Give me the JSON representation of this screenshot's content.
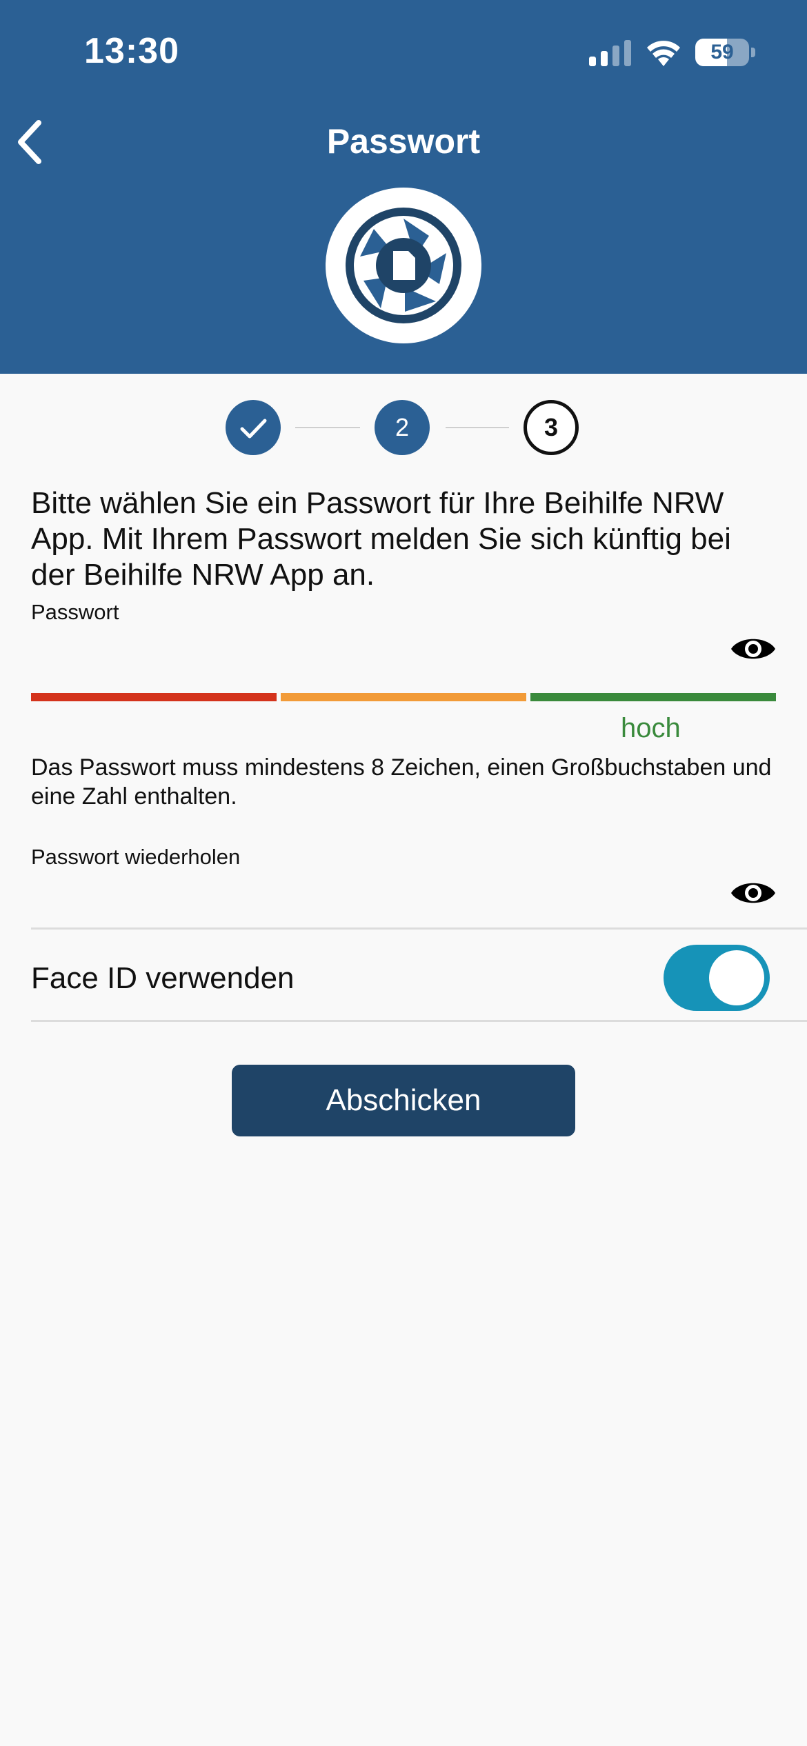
{
  "status_bar": {
    "time": "13:30",
    "battery": "59",
    "battery_level": 0.59,
    "icons": [
      "signal-icon",
      "wifi-icon",
      "battery-icon"
    ]
  },
  "nav": {
    "title": "Passwort",
    "back_icon": "chevron-left-icon"
  },
  "stepper": {
    "steps": [
      {
        "state": "done",
        "label": ""
      },
      {
        "state": "active",
        "label": "2"
      },
      {
        "state": "todo",
        "label": "3"
      }
    ]
  },
  "intro_text": "Bitte wählen Sie ein Passwort für Ihre Beihilfe NRW App. Mit Ihrem Passwort melden Sie sich künftig bei der Beihilfe NRW App an.",
  "password": {
    "label": "Passwort",
    "value": "",
    "strength_label": "hoch",
    "strength_colors": [
      "#d4331c",
      "#f29b38",
      "#3a8a3c"
    ]
  },
  "hint": "Das Passwort muss mindestens 8 Zeichen, einen Großbuchstaben und eine Zahl enthalten.",
  "repeat_password": {
    "label": "Passwort wiederholen",
    "value": ""
  },
  "face_id": {
    "label": "Face ID verwenden",
    "enabled": true
  },
  "submit_label": "Abschicken",
  "colors": {
    "header": "#2b6094",
    "button": "#1f4467",
    "toggle_on": "#1693b8"
  }
}
